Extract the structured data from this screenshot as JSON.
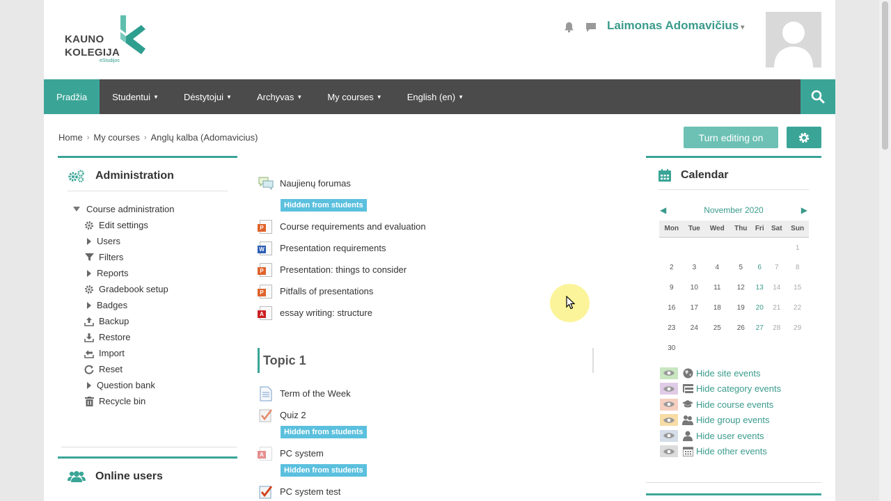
{
  "header": {
    "logo_line1": "KAUNO",
    "logo_line2": "KOLEGIJA",
    "logo_sub": "eStudijos",
    "username": "Laimonas Adomavičius"
  },
  "nav": {
    "items": [
      {
        "label": "Pradžia",
        "active": true
      },
      {
        "label": "Studentui",
        "caret": true
      },
      {
        "label": "Dėstytojui",
        "caret": true
      },
      {
        "label": "Archyvas",
        "caret": true
      },
      {
        "label": "My courses",
        "caret": true
      },
      {
        "label": "English (en)",
        "caret": true
      }
    ]
  },
  "breadcrumb": [
    "Home",
    "My courses",
    "Anglų kalba (Adomavicius)"
  ],
  "buttons": {
    "edit": "Turn editing on"
  },
  "admin": {
    "title": "Administration",
    "root": "Course administration",
    "items": [
      {
        "label": "Edit settings",
        "icon": "gear-icon"
      },
      {
        "label": "Users",
        "icon": "arrow"
      },
      {
        "label": "Filters",
        "icon": "filter-icon"
      },
      {
        "label": "Reports",
        "icon": "arrow"
      },
      {
        "label": "Gradebook setup",
        "icon": "gear-icon"
      },
      {
        "label": "Badges",
        "icon": "arrow"
      },
      {
        "label": "Backup",
        "icon": "upload-icon"
      },
      {
        "label": "Restore",
        "icon": "download-icon"
      },
      {
        "label": "Import",
        "icon": "import-icon"
      },
      {
        "label": "Reset",
        "icon": "reset-icon"
      },
      {
        "label": "Question bank",
        "icon": "arrow"
      },
      {
        "label": "Recycle bin",
        "icon": "trash-icon"
      }
    ]
  },
  "online": {
    "title": "Online users"
  },
  "activities": {
    "forum": "Naujienų forumas",
    "hidden_label": "Hidden from students",
    "files": [
      {
        "label": "Course requirements and evaluation",
        "type": "ppt"
      },
      {
        "label": "Presentation requirements",
        "type": "doc"
      },
      {
        "label": "Presentation: things to consider",
        "type": "ppt"
      },
      {
        "label": "Pitfalls of presentations",
        "type": "ppt"
      },
      {
        "label": "essay writing: structure",
        "type": "pdf"
      }
    ]
  },
  "topic1": {
    "title": "Topic 1",
    "items": [
      {
        "label": "Term of the Week",
        "type": "page",
        "hidden": false
      },
      {
        "label": "Quiz 2",
        "type": "quiz",
        "hidden": true
      },
      {
        "label": "PC system",
        "type": "pdf-faded",
        "hidden": true
      },
      {
        "label": "PC system test",
        "type": "quiz",
        "hidden": false
      }
    ]
  },
  "calendar": {
    "title": "Calendar",
    "month": "November 2020",
    "days": [
      "Mon",
      "Tue",
      "Wed",
      "Thu",
      "Fri",
      "Sat",
      "Sun"
    ],
    "weeks": [
      [
        "",
        "",
        "",
        "",
        "",
        "",
        "1"
      ],
      [
        "2",
        "3",
        "4",
        "5",
        "6",
        "7",
        "8"
      ],
      [
        "9",
        "10",
        "11",
        "12",
        "13",
        "14",
        "15"
      ],
      [
        "16",
        "17",
        "18",
        "19",
        "20",
        "21",
        "22"
      ],
      [
        "23",
        "24",
        "25",
        "26",
        "27",
        "28",
        "29"
      ],
      [
        "30",
        "",
        "",
        "",
        "",
        "",
        ""
      ]
    ],
    "legend": [
      {
        "label": "Hide site events",
        "color": "#c8e6c0",
        "icon": "globe-icon"
      },
      {
        "label": "Hide category events",
        "color": "#e0cbe6",
        "icon": "category-icon"
      },
      {
        "label": "Hide course events",
        "color": "#f5cfc0",
        "icon": "course-icon"
      },
      {
        "label": "Hide group events",
        "color": "#f7dca6",
        "icon": "group-icon"
      },
      {
        "label": "Hide user events",
        "color": "#d4dde8",
        "icon": "user-icon"
      },
      {
        "label": "Hide other events",
        "color": "#dcdcdc",
        "icon": "calendar-icon"
      }
    ]
  },
  "colors": {
    "accent": "#3aa597",
    "nav": "#4b4b4b",
    "badge": "#5bc0de"
  }
}
